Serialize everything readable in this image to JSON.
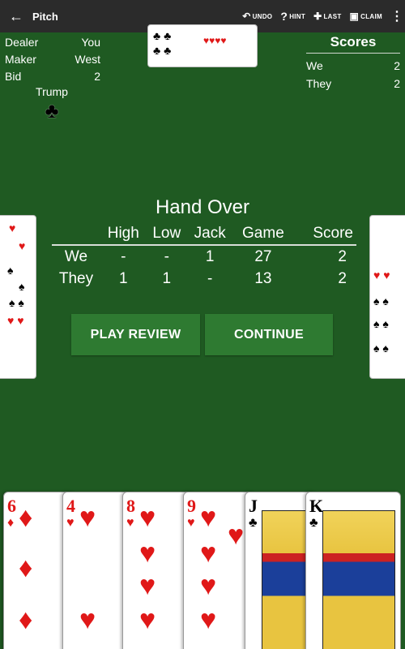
{
  "topbar": {
    "back_icon": "arrow-left-icon",
    "title": "Pitch",
    "actions": [
      {
        "icon": "undo-icon",
        "glyph": "↶",
        "label": "UNDO"
      },
      {
        "icon": "hint-icon",
        "glyph": "?",
        "label": "HINT"
      },
      {
        "icon": "last-trick-icon",
        "glyph": "✚",
        "label": "LAST"
      },
      {
        "icon": "claim-icon",
        "glyph": "▣",
        "label": "CLAIM"
      }
    ],
    "menu_glyph": "⋮"
  },
  "info": {
    "rows": [
      {
        "label": "Dealer",
        "value": "You"
      },
      {
        "label": "Maker",
        "value": "West"
      },
      {
        "label": "Bid",
        "value": "2"
      }
    ],
    "trump_label": "Trump",
    "trump_suit": "♣"
  },
  "scores": {
    "title": "Scores",
    "rows": [
      {
        "team": "We",
        "score": "2"
      },
      {
        "team": "They",
        "score": "2"
      }
    ]
  },
  "hand_over": {
    "title": "Hand Over",
    "columns": [
      "",
      "High",
      "Low",
      "Jack",
      "Game",
      "Score"
    ],
    "rows": [
      {
        "team": "We",
        "high": "-",
        "low": "-",
        "jack": "1",
        "game": "27",
        "score": "2"
      },
      {
        "team": "They",
        "high": "1",
        "low": "1",
        "jack": "-",
        "game": "13",
        "score": "2"
      }
    ]
  },
  "buttons": {
    "play_review": "PLAY REVIEW",
    "continue": "CONTINUE"
  },
  "player_hand": [
    {
      "rank": "6",
      "suit": "♦",
      "color": "#e01818"
    },
    {
      "rank": "4",
      "suit": "♥",
      "color": "#e01818"
    },
    {
      "rank": "8",
      "suit": "♥",
      "color": "#e01818"
    },
    {
      "rank": "9",
      "suit": "♥",
      "color": "#e01818"
    },
    {
      "rank": "J",
      "suit": "♣",
      "color": "#000000"
    },
    {
      "rank": "K",
      "suit": "♣",
      "color": "#000000"
    }
  ]
}
